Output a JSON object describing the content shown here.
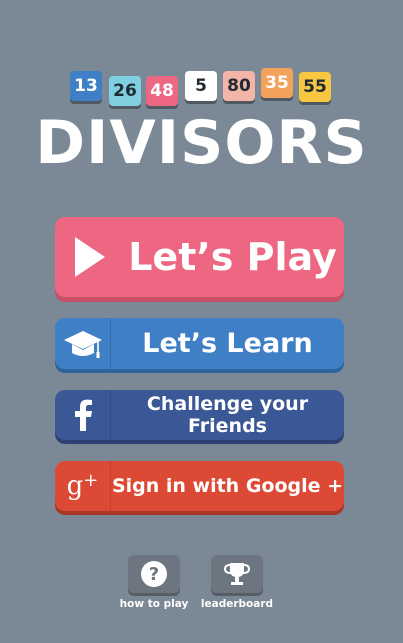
{
  "tiles": [
    {
      "value": "13",
      "bg": "#3e7fc6",
      "fg": "#ffffff"
    },
    {
      "value": "26",
      "bg": "#7fcfe0",
      "fg": "#1f2a33"
    },
    {
      "value": "48",
      "bg": "#ee6782",
      "fg": "#ffffff"
    },
    {
      "value": "5",
      "bg": "#ffffff",
      "fg": "#1f2a33"
    },
    {
      "value": "80",
      "bg": "#f2b5a8",
      "fg": "#1f2a33"
    },
    {
      "value": "35",
      "bg": "#f2a25a",
      "fg": "#ffffff"
    },
    {
      "value": "55",
      "bg": "#f7c742",
      "fg": "#1f2a33"
    }
  ],
  "logo": "DIVISORS",
  "buttons": {
    "play": "Let’s Play",
    "learn": "Let’s Learn",
    "facebook": "Challenge your Friends",
    "google": "Sign in with Google +"
  },
  "bottom": {
    "how_to_play": "how to play",
    "leaderboard": "leaderboard"
  },
  "icons": {
    "play": "play-icon",
    "learn": "graduation-cap-icon",
    "facebook": "facebook-icon",
    "google": "google-plus-icon",
    "help": "question-icon",
    "trophy": "trophy-icon"
  },
  "colors": {
    "background": "#7b8895",
    "play": "#ee6782",
    "learn": "#3e7fc6",
    "facebook": "#3a5796",
    "google": "#dc4a36"
  }
}
